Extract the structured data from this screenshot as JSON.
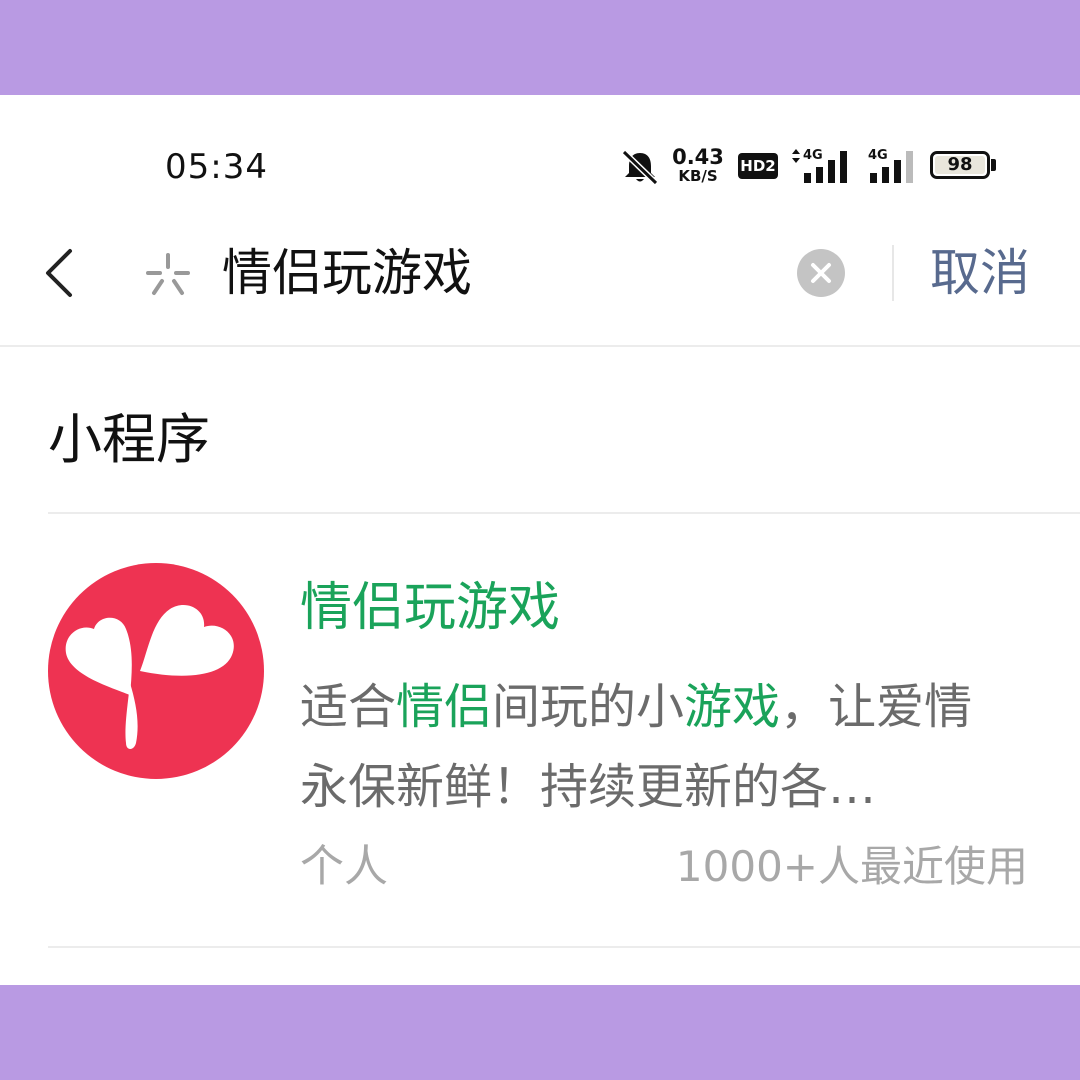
{
  "status_bar": {
    "time": "05:34",
    "net_speed_value": "0.43",
    "net_speed_unit": "KB/S",
    "hd_badge": "HD2",
    "signal1_label": "4G",
    "signal2_label": "4G",
    "battery_level": "98",
    "icons": [
      "bell-mute-icon",
      "signal-icon",
      "battery-icon"
    ]
  },
  "search": {
    "back_icon": "chevron-left-icon",
    "search_icon": "sparkle-search-icon",
    "query": "情侣玩游戏",
    "clear_icon": "clear-icon",
    "cancel_label": "取消"
  },
  "section": {
    "title": "小程序"
  },
  "result": {
    "icon": "heart-clover-logo",
    "name": "情侣玩游戏",
    "description": {
      "p1": "适合",
      "h1": "情侣",
      "p2": "间玩的小",
      "h2": "游戏",
      "p3": "，让爱情永保新鲜！持续更新的各…"
    },
    "category": "个人",
    "usage": "1000+人最近使用"
  },
  "colors": {
    "background_frame": "#b99ae3",
    "highlight": "#1aa35a",
    "cancel_link": "#586a8e",
    "logo_red": "#ee3352"
  }
}
